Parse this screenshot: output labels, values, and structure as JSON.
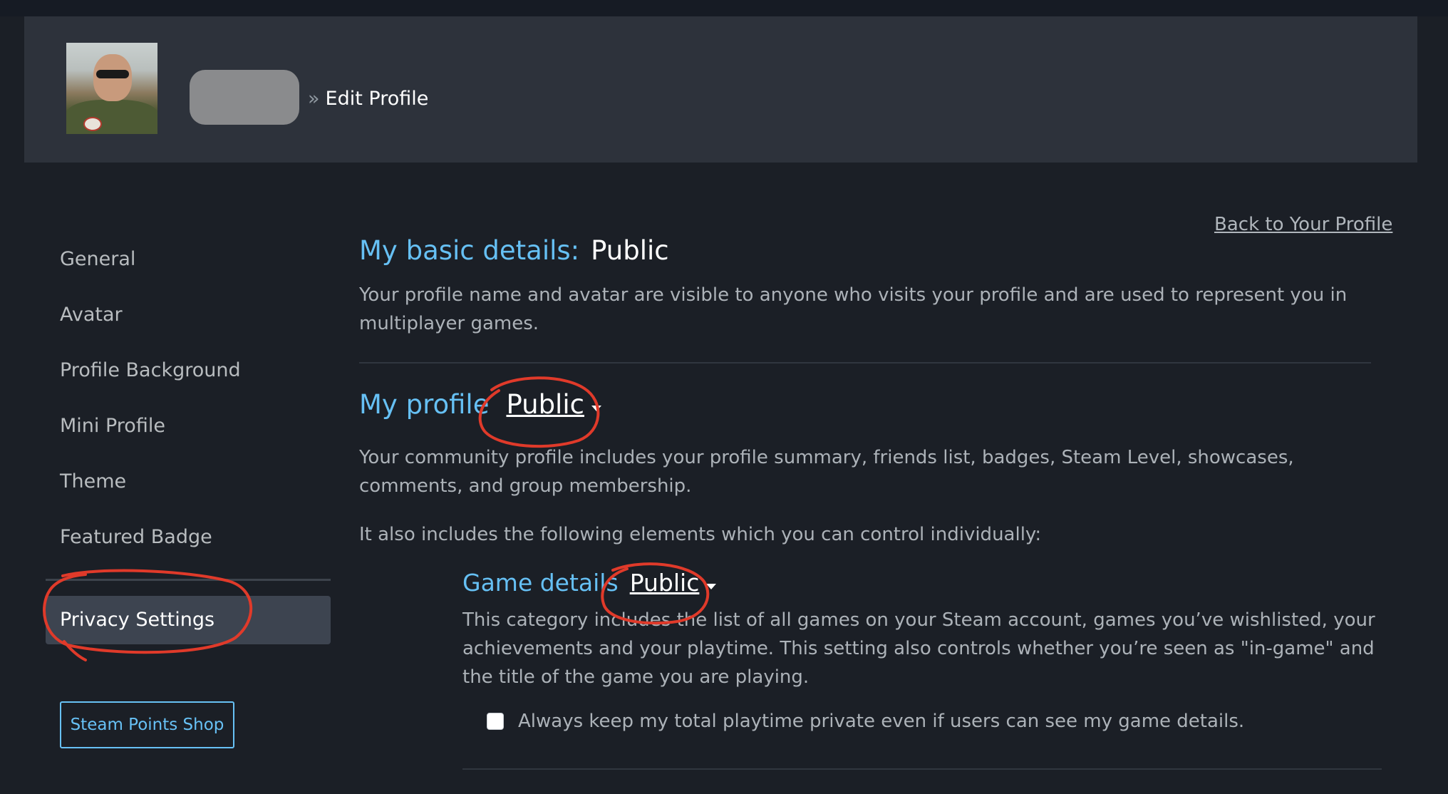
{
  "header": {
    "crumb_sep": "»",
    "crumb_page": "Edit Profile",
    "back_link": "Back to Your Profile"
  },
  "sidebar": {
    "items": [
      {
        "label": "General"
      },
      {
        "label": "Avatar"
      },
      {
        "label": "Profile Background"
      },
      {
        "label": "Mini Profile"
      },
      {
        "label": "Theme"
      },
      {
        "label": "Featured Badge"
      }
    ],
    "active_item": "Privacy Settings",
    "points_shop_button": "Steam Points Shop"
  },
  "privacy": {
    "basic_details": {
      "label": "My basic details:",
      "value": "Public",
      "description": "Your profile name and avatar are visible to anyone who visits your profile and are used to represent you in multiplayer games."
    },
    "profile": {
      "label": "My profile",
      "value": "Public",
      "description": "Your community profile includes your profile summary, friends list, badges, Steam Level, showcases, comments, and group membership.",
      "sub_intro": "It also includes the following elements which you can control individually:"
    },
    "game_details": {
      "label": "Game details",
      "value": "Public",
      "description": "This category includes the list of all games on your Steam account, games you’ve wishlisted, your achievements and your playtime. This setting also controls whether you’re seen as \"in-game\" and the title of the game you are playing.",
      "checkbox_label": "Always keep my total playtime private even if users can see my game details.",
      "checkbox_checked": false
    }
  },
  "colors": {
    "accent_blue": "#66c0f4",
    "annotation_red": "#e03a2a",
    "background": "#1b1f26"
  }
}
